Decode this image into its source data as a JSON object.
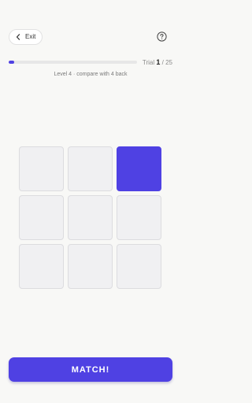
{
  "header": {
    "exit_label": "Exit",
    "exit_icon": "chevron-left-icon",
    "help_icon": "help-circle-icon"
  },
  "progress": {
    "current_trial": 1,
    "total_trials": 25,
    "trial_label": "Trial",
    "separator": "/",
    "fraction": 0.04
  },
  "level_info": "Level 4 · compare with 4 back",
  "grid": {
    "rows": 3,
    "cols": 3,
    "active_index": 2
  },
  "match_button_label": "MATCH!",
  "colors": {
    "accent": "#4f41e3",
    "background": "#f8f8f6",
    "cell": "#f0f0f2"
  }
}
